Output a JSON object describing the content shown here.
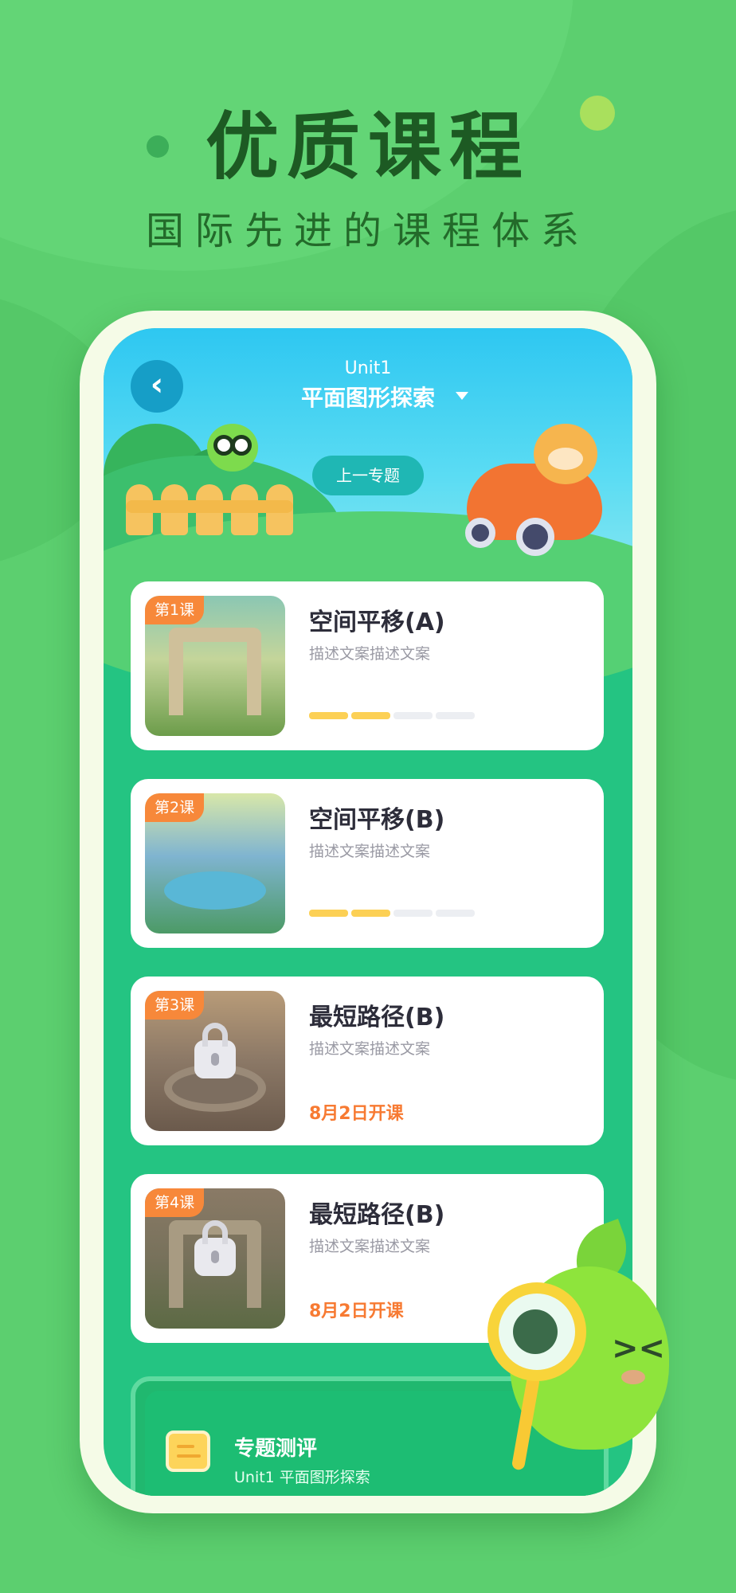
{
  "hero": {
    "title": "优质课程",
    "subtitle": "国际先进的课程体系"
  },
  "header": {
    "back_icon": "‹",
    "unit_label": "Unit1",
    "topic_title": "平面图形探索",
    "prev_topic_button": "上一专题"
  },
  "lessons": [
    {
      "badge": "第1课",
      "title": "空间平移(A)",
      "description": "描述文案描述文案",
      "progress_segments_done": 2,
      "progress_segments_total": 4,
      "locked": false
    },
    {
      "badge": "第2课",
      "title": "空间平移(B)",
      "description": "描述文案描述文案",
      "progress_segments_done": 2,
      "progress_segments_total": 4,
      "locked": false
    },
    {
      "badge": "第3课",
      "title": "最短路径(B)",
      "description": "描述文案描述文案",
      "start_date": "8月2日开课",
      "locked": true
    },
    {
      "badge": "第4课",
      "title": "最短路径(B)",
      "description": "描述文案描述文案",
      "start_date": "8月2日开课",
      "locked": true
    }
  ],
  "assessment": {
    "title": "专题测评",
    "subtitle": "Unit1 平面图形探索"
  },
  "colors": {
    "background": "#5ccf6f",
    "hero_text": "#1d5a23",
    "badge": "#f7883a",
    "progress_on": "#fcd055",
    "date_text": "#f77a32"
  }
}
